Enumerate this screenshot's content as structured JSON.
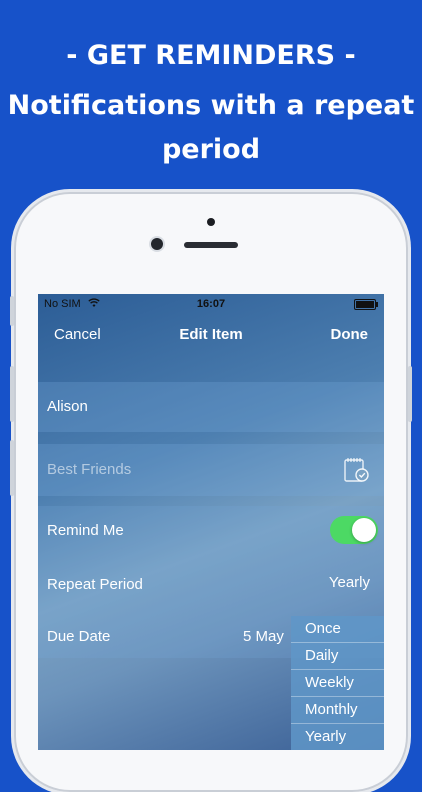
{
  "headline": {
    "line1": "- GET REMINDERS -",
    "line2": "Notifications with a repeat",
    "line3": "period"
  },
  "status_bar": {
    "carrier": "No SIM",
    "time": "16:07"
  },
  "nav": {
    "cancel": "Cancel",
    "title": "Edit Item",
    "done": "Done"
  },
  "form": {
    "name_value": "Alison",
    "group_placeholder": "Best Friends",
    "remind_label": "Remind Me",
    "remind_on": true,
    "repeat_label": "Repeat Period",
    "repeat_value": "Yearly",
    "due_label": "Due Date",
    "due_value": "5 May"
  },
  "repeat_options": [
    "Once",
    "Daily",
    "Weekly",
    "Monthly",
    "Yearly"
  ],
  "colors": {
    "background": "#1752c9",
    "toggle_on": "#4cd964"
  }
}
